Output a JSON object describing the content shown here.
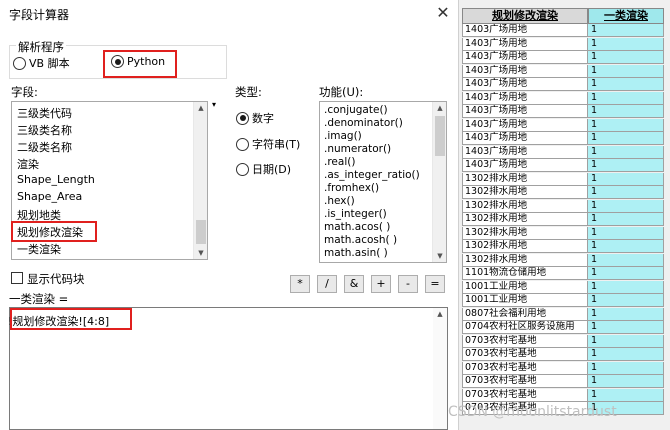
{
  "dialog": {
    "title": "字段计算器",
    "close_glyph": "✕",
    "parser": {
      "label": "解析程序",
      "vb_label": "VB 脚本",
      "python_label": "Python",
      "selected": "Python"
    },
    "fields": {
      "label": "字段:",
      "items": [
        "三级类代码",
        "三级类名称",
        "二级类名称",
        "渲染",
        "Shape_Length",
        "Shape_Area",
        "规划地类",
        "规划修改渲染",
        "一类渲染"
      ],
      "highlighted": "规划修改渲染"
    },
    "type": {
      "label": "类型:",
      "number": "数字",
      "string": "字符串(T)",
      "date": "日期(D)",
      "selected": "数字"
    },
    "functions": {
      "label": "功能(U):",
      "items": [
        ".conjugate()",
        ".denominator()",
        ".imag()",
        ".numerator()",
        ".real()",
        ".as_integer_ratio()",
        ".fromhex()",
        ".hex()",
        ".is_integer()",
        "math.acos( )",
        "math.acosh( )",
        "math.asin( )"
      ]
    },
    "show_codeblock_label": "显示代码块",
    "operators": [
      "*",
      "/",
      "&",
      "+",
      "-",
      "="
    ],
    "expression_label": "一类渲染 =",
    "expression_value": "!规划修改渲染![4:8]"
  },
  "table": {
    "headers": [
      "规划修改渲染",
      "一类渲染"
    ],
    "rows": [
      [
        "1403广场用地",
        "1"
      ],
      [
        "1403广场用地",
        "1"
      ],
      [
        "1403广场用地",
        "1"
      ],
      [
        "1403广场用地",
        "1"
      ],
      [
        "1403广场用地",
        "1"
      ],
      [
        "1403广场用地",
        "1"
      ],
      [
        "1403广场用地",
        "1"
      ],
      [
        "1403广场用地",
        "1"
      ],
      [
        "1403广场用地",
        "1"
      ],
      [
        "1403广场用地",
        "1"
      ],
      [
        "1403广场用地",
        "1"
      ],
      [
        "1302排水用地",
        "1"
      ],
      [
        "1302排水用地",
        "1"
      ],
      [
        "1302排水用地",
        "1"
      ],
      [
        "1302排水用地",
        "1"
      ],
      [
        "1302排水用地",
        "1"
      ],
      [
        "1302排水用地",
        "1"
      ],
      [
        "1302排水用地",
        "1"
      ],
      [
        "1101物流仓储用地",
        "1"
      ],
      [
        "1001工业用地",
        "1"
      ],
      [
        "1001工业用地",
        "1"
      ],
      [
        "0807社会福利用地",
        "1"
      ],
      [
        "0704农村社区服务设施用",
        "1"
      ],
      [
        "0703农村宅基地",
        "1"
      ],
      [
        "0703农村宅基地",
        "1"
      ],
      [
        "0703农村宅基地",
        "1"
      ],
      [
        "0703农村宅基地",
        "1"
      ],
      [
        "0703农村宅基地",
        "1"
      ],
      [
        "0703农村宅基地",
        "1"
      ]
    ]
  },
  "watermark": "CSDN @moonlitstardust"
}
